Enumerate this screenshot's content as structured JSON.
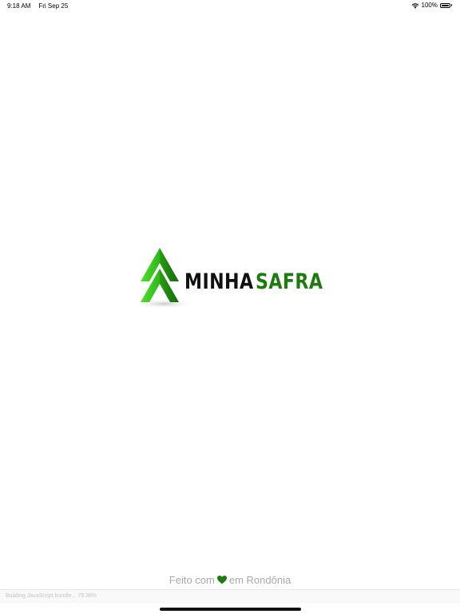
{
  "status_bar": {
    "time": "9:18 AM",
    "date": "Fri Sep 25",
    "battery": "100%",
    "battery_level": 1.0
  },
  "brand": {
    "word1": "MINHA",
    "word2": "SAFRA",
    "word1_color": "#111111",
    "word2_color": "#1f7a10",
    "accent_green": "#3ecf1f",
    "dark_green": "#1a7a10"
  },
  "footer": {
    "before_heart": "Feito com",
    "heart_icon": "heart-icon",
    "after_heart": "em Rondônia",
    "heart_color": "#1f7a10"
  },
  "bundle": {
    "status_text": "Building JavaScript bundle... 79.38%",
    "progress_percent": 79.38
  }
}
